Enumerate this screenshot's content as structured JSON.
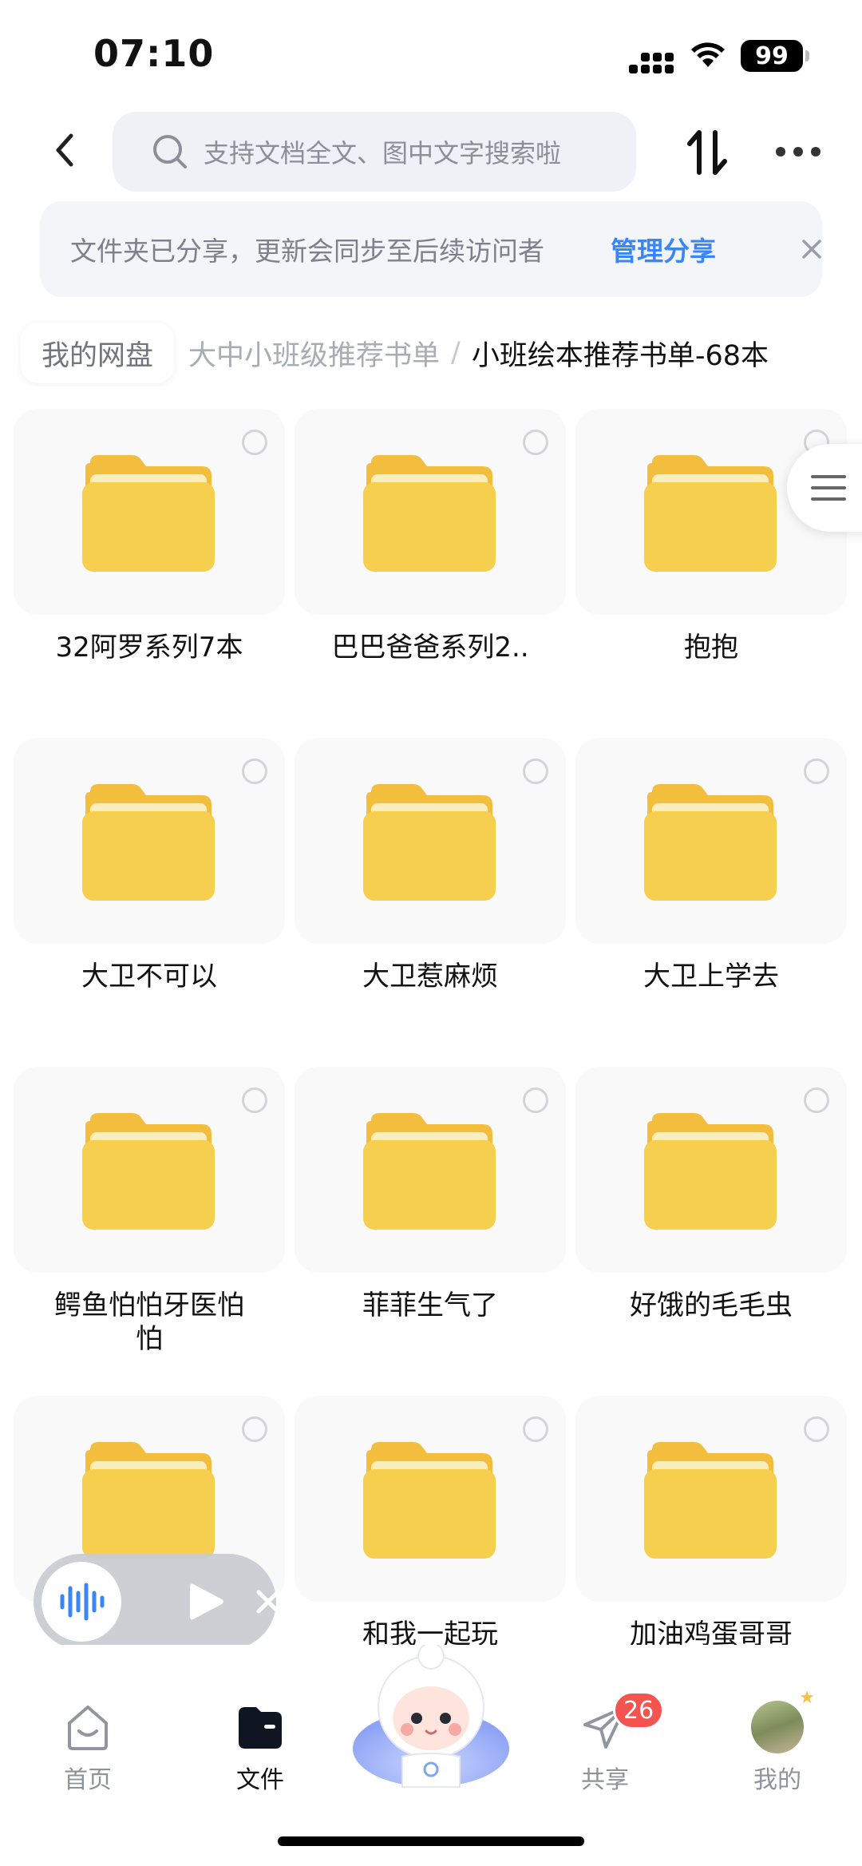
{
  "status_bar": {
    "time": "07:10",
    "battery": "99"
  },
  "search": {
    "placeholder": "支持文档全文、图中文字搜索啦"
  },
  "share_notice": {
    "message": "文件夹已分享，更新会同步至后续访问者",
    "action_label": "管理分享"
  },
  "breadcrumb": {
    "root": "我的网盘",
    "parent": "大中小班级推荐书单",
    "separator": "/",
    "current": "小班绘本推荐书单-68本"
  },
  "folders": [
    {
      "name": "32阿罗系列7本"
    },
    {
      "name": "巴巴爸爸系列2.."
    },
    {
      "name": "抱抱"
    },
    {
      "name": "大卫不可以"
    },
    {
      "name": "大卫惹麻烦"
    },
    {
      "name": "大卫上学去"
    },
    {
      "name": "鳄鱼怕怕牙医怕怕"
    },
    {
      "name": "菲菲生气了"
    },
    {
      "name": "好饿的毛毛虫"
    },
    {
      "name": ""
    },
    {
      "name": "和我一起玩"
    },
    {
      "name": "加油鸡蛋哥哥"
    }
  ],
  "bottom_nav": {
    "items": [
      {
        "label": "首页"
      },
      {
        "label": "文件"
      },
      {
        "label": "共享",
        "badge": "26"
      },
      {
        "label": "我的"
      }
    ]
  },
  "colors": {
    "accent": "#3b86f7",
    "folder": "#f7cf4f",
    "badge": "#f5534f"
  }
}
